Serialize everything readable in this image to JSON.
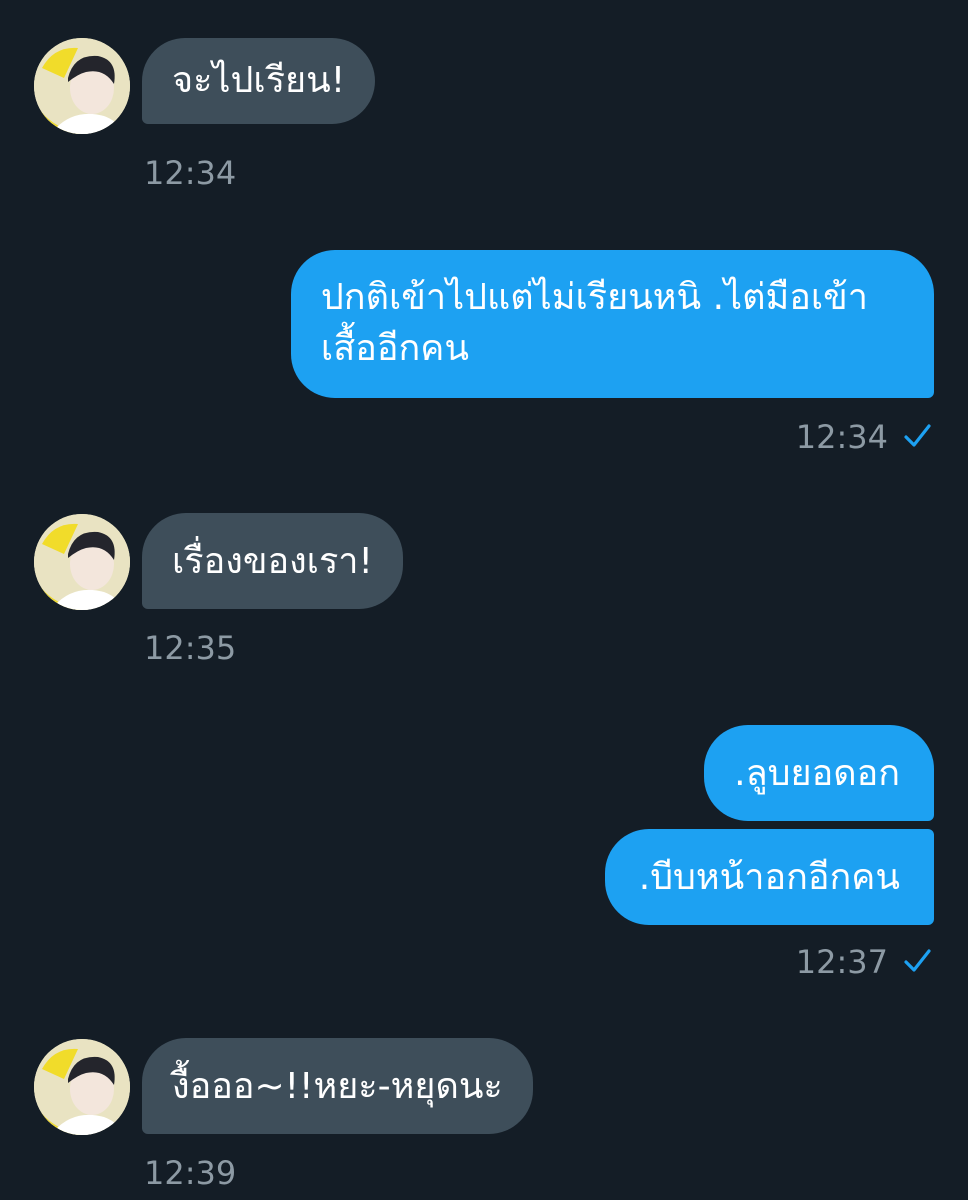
{
  "colors": {
    "background": "#141d26",
    "incoming_bubble": "#3e4e5a",
    "outgoing_bubble": "#1da1f2",
    "timestamp": "#8d9aa4",
    "read_check": "#1da1f2"
  },
  "messages": [
    {
      "direction": "incoming",
      "text": "จะไปเรียน!",
      "time": "12:34",
      "avatar_icon": "user-avatar-icon"
    },
    {
      "direction": "outgoing",
      "lines": [
        "ปกติเข้าไปแต่ไม่เรียนหนิ .ไต่มือเข้า",
        "เสื้ออีกคน"
      ],
      "time": "12:34",
      "status_icon": "read-check-icon"
    },
    {
      "direction": "incoming",
      "text": "เรื่องของเรา!",
      "time": "12:35",
      "avatar_icon": "user-avatar-icon"
    },
    {
      "direction": "outgoing",
      "text": ".ลูบยอดอก"
    },
    {
      "direction": "outgoing",
      "text": ".บีบหน้าอกอีกคน",
      "time": "12:37",
      "status_icon": "read-check-icon"
    },
    {
      "direction": "incoming",
      "text": "งื้อออ~!!หยะ-หยุดนะ",
      "time": "12:39",
      "avatar_icon": "user-avatar-icon"
    }
  ]
}
